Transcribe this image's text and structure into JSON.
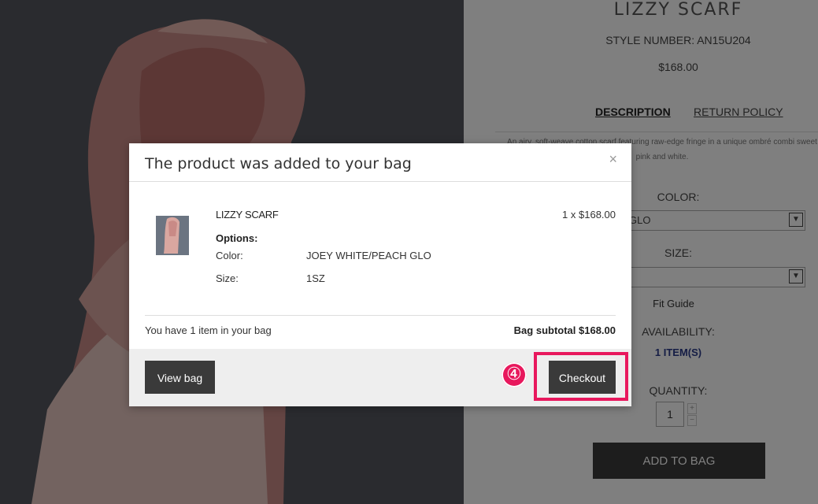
{
  "product": {
    "title": "LIZZY SCARF",
    "style_number": "STYLE NUMBER: AN15U204",
    "price": "$168.00",
    "tabs": [
      {
        "label": "DESCRIPTION",
        "active": true
      },
      {
        "label": "RETURN POLICY",
        "active": false
      }
    ],
    "description": "An airy, soft-weave cotton scarf featuring raw-edge fringe in a unique ombré combi sweet pink and white.",
    "color_label": "COLOR:",
    "color_value": "ACH GLO",
    "size_label": "SIZE:",
    "size_value": "",
    "fit_guide": "Fit Guide",
    "availability_label": "AVAILABILITY:",
    "availability_value": "1 ITEM(S)",
    "quantity_label": "QUANTITY:",
    "quantity_value": "1",
    "qty_plus": "+",
    "qty_minus": "−",
    "add_to_bag": "ADD TO BAG"
  },
  "modal": {
    "title": "The product was added to your bag",
    "close": "×",
    "item": {
      "name": "LIZZY SCARF",
      "price_line": "1 x $168.00",
      "options_heading": "Options:",
      "options": [
        {
          "key": "Color:",
          "value": "JOEY WHITE/PEACH GLO"
        },
        {
          "key": "Size:",
          "value": "1SZ"
        }
      ]
    },
    "bag_count": "You have 1 item in your bag",
    "subtotal": "Bag subtotal $168.00",
    "view_bag": "View bag",
    "checkout": "Checkout"
  },
  "annotation": {
    "step": "④",
    "color": "#e8185d"
  }
}
